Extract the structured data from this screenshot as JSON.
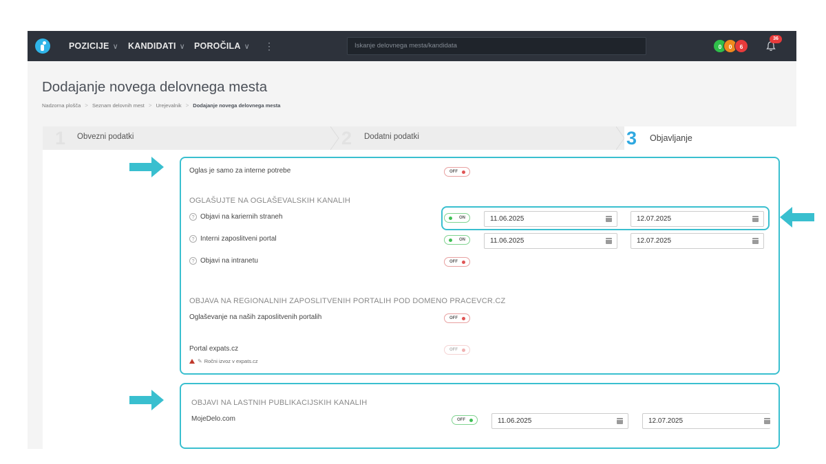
{
  "topbar": {
    "nav": [
      {
        "label": "POZICIJE"
      },
      {
        "label": "KANDIDATI"
      },
      {
        "label": "POROČILA"
      }
    ],
    "more_icon": "⋮",
    "search_placeholder": "Iskanje delovnega mesta/kandidata",
    "counters": [
      {
        "value": "0",
        "color": "#2fbf4a"
      },
      {
        "value": "0",
        "color": "#f08a1d"
      },
      {
        "value": "6",
        "color": "#e83b3b"
      }
    ],
    "notifications_count": "36"
  },
  "page": {
    "title": "Dodajanje novega delovnega mesta",
    "breadcrumb": [
      "Nadzorna plošča",
      "Seznam delovnih mest",
      "Urejevalnik",
      "Dodajanje novega delovnega mesta"
    ]
  },
  "steps": [
    {
      "number": "1",
      "label": "Obvezni podatki",
      "active": false
    },
    {
      "number": "2",
      "label": "Dodatni podatki",
      "active": false
    },
    {
      "number": "3",
      "label": "Objavljanje",
      "active": true
    }
  ],
  "panel1": {
    "internal_label": "Oglas je samo za interne potrebe",
    "internal_toggle": "OFF",
    "channels_heading": "OGLAŠUJTE NA OGLAŠEVALSKIH KANALIH",
    "channels": [
      {
        "label": "Objavi na kariernih straneh",
        "toggle": "ON",
        "date_from": "11.06.2025",
        "date_to": "12.07.2025"
      },
      {
        "label": "Interni zaposlitveni portal",
        "toggle": "ON",
        "date_from": "11.06.2025",
        "date_to": "12.07.2025"
      },
      {
        "label": "Objavi na intranetu",
        "toggle": "OFF"
      }
    ],
    "regional_heading": "OBJAVA NA REGIONALNIH ZAPOSLITVENIH PORTALIH POD DOMENO PRACEVCR.CZ",
    "regional_label": "Oglaševanje na naših zaposlitvenih portalih",
    "regional_toggle": "OFF",
    "expats_label": "Portal expats.cz",
    "expats_toggle": "OFF",
    "expats_note": "Ročni izvoz v expats.cz"
  },
  "panel2": {
    "heading": "OBJAVI NA LASTNIH PUBLIKACIJSKIH KANALIH",
    "label": "MojeDelo.com",
    "toggle": "OFF",
    "date_from": "11.06.2025",
    "date_to": "12.07.2025"
  },
  "colors": {
    "accent": "#39bfcf",
    "topbar": "#2d323b",
    "step_active": "#2fa8e0"
  }
}
